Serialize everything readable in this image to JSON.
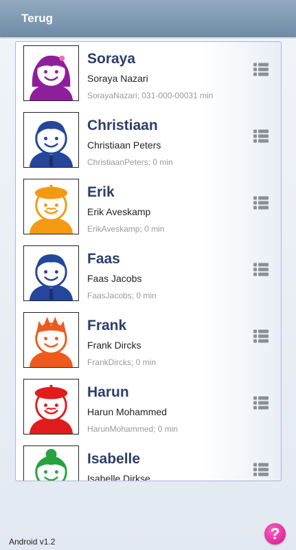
{
  "header": {
    "back_label": "Terug"
  },
  "contacts": [
    {
      "first": "Soraya",
      "full": "Soraya Nazari",
      "meta": "SorayaNazari; 031-000-00031 min",
      "color": "#8e1f9b",
      "avatar": "girl-icon"
    },
    {
      "first": "Christiaan",
      "full": "Christiaan Peters",
      "meta": "ChristiaanPeters; 0 min",
      "color": "#24479b",
      "avatar": "boy-tie-icon"
    },
    {
      "first": "Erik",
      "full": "Erik Aveskamp",
      "meta": "ErikAveskamp; 0 min",
      "color": "#f39a12",
      "avatar": "boy-beret-icon"
    },
    {
      "first": "Faas",
      "full": "Faas Jacobs",
      "meta": "FaasJacobs; 0 min",
      "color": "#24479b",
      "avatar": "boy-tie-icon"
    },
    {
      "first": "Frank",
      "full": "Frank Dircks",
      "meta": "FrankDircks; 0 min",
      "color": "#ef5a1c",
      "avatar": "boy-spiky-icon"
    },
    {
      "first": "Harun",
      "full": "Harun Mohammed",
      "meta": "HarunMohammed; 0 min",
      "color": "#e01c1c",
      "avatar": "boy-beret-icon"
    },
    {
      "first": "Isabelle",
      "full": "Isabelle Dirkse",
      "meta": "",
      "color": "#27a23c",
      "avatar": "girl-bun-icon"
    }
  ],
  "footer": {
    "version": "Android v1.2",
    "help_label": "?"
  }
}
